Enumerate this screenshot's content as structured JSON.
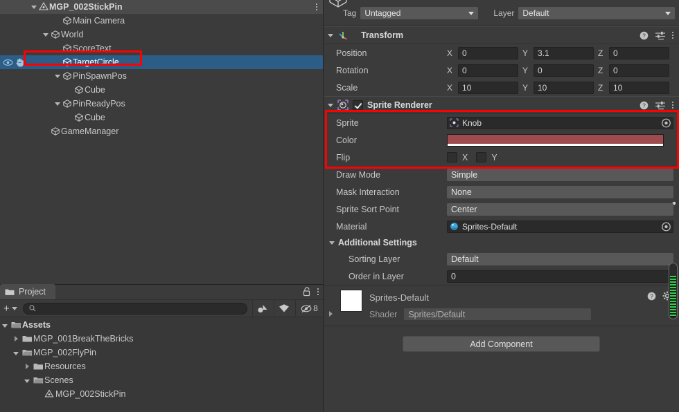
{
  "hierarchy": {
    "scene": {
      "name": "MGP_002StickPin",
      "icon": "unity-scene-icon",
      "menu_icon": "kebab-menu-icon"
    },
    "items": [
      {
        "label": "Main Camera",
        "depth": 2,
        "expander": "none",
        "selected": false,
        "icon": "gameobject-cube-icon"
      },
      {
        "label": "World",
        "depth": 1,
        "expander": "down",
        "selected": false,
        "icon": "gameobject-cube-icon"
      },
      {
        "label": "ScoreText",
        "depth": 2,
        "expander": "none",
        "selected": false,
        "icon": "gameobject-cube-icon"
      },
      {
        "label": "TargetCircle",
        "depth": 2,
        "expander": "none",
        "selected": true,
        "icon": "gameobject-cube-icon"
      },
      {
        "label": "PinSpawnPos",
        "depth": 2,
        "expander": "down",
        "selected": false,
        "icon": "gameobject-cube-icon"
      },
      {
        "label": "Cube",
        "depth": 3,
        "expander": "none",
        "selected": false,
        "icon": "gameobject-cube-icon"
      },
      {
        "label": "PinReadyPos",
        "depth": 2,
        "expander": "down",
        "selected": false,
        "icon": "gameobject-cube-icon"
      },
      {
        "label": "Cube",
        "depth": 3,
        "expander": "none",
        "selected": false,
        "icon": "gameobject-cube-icon"
      },
      {
        "label": "GameManager",
        "depth": 1,
        "expander": "none",
        "selected": false,
        "icon": "gameobject-cube-icon"
      }
    ],
    "gutter_icons": [
      "visibility-eye-icon",
      "pickability-hand-icon"
    ]
  },
  "project": {
    "tab_label": "Project",
    "tab_icon": "folder-icon",
    "lock_icon": "lock-open-icon",
    "menu_icon": "kebab-menu-icon",
    "create_label": "+",
    "search": {
      "value": "",
      "placeholder": "",
      "icon": "search-icon"
    },
    "filter_buttons": [
      {
        "name": "filter-by-type-icon",
        "label": ""
      },
      {
        "name": "filter-by-label-icon",
        "label": ""
      },
      {
        "name": "hidden-items-icon",
        "label": "8"
      }
    ],
    "tree": [
      {
        "label": "Assets",
        "depth": 0,
        "expander": "down",
        "folder": "open",
        "bold": true
      },
      {
        "label": "MGP_001BreakTheBricks",
        "depth": 1,
        "expander": "right",
        "folder": "closed",
        "bold": false
      },
      {
        "label": "MGP_002FlyPin",
        "depth": 1,
        "expander": "down",
        "folder": "open",
        "bold": false
      },
      {
        "label": "Resources",
        "depth": 2,
        "expander": "right",
        "folder": "closed",
        "bold": false
      },
      {
        "label": "Scenes",
        "depth": 2,
        "expander": "down",
        "folder": "open",
        "bold": false
      },
      {
        "label": "MGP_002StickPin",
        "depth": 3,
        "expander": "none",
        "folder": "scene",
        "bold": false
      }
    ]
  },
  "inspector": {
    "preview_icon": "gameobject-cube-icon",
    "tag": {
      "label": "Tag",
      "value": "Untagged"
    },
    "layer": {
      "label": "Layer",
      "value": "Default"
    },
    "transform": {
      "title": "Transform",
      "icon": "transform-axis-icon",
      "help_icon": "help-icon",
      "preset_icon": "preset-icon",
      "menu_icon": "kebab-menu-icon",
      "rows": [
        {
          "label": "Position",
          "x": "0",
          "y": "3.1",
          "z": "0"
        },
        {
          "label": "Rotation",
          "x": "0",
          "y": "0",
          "z": "0"
        },
        {
          "label": "Scale",
          "x": "10",
          "y": "10",
          "z": "10"
        }
      ],
      "axes": [
        "X",
        "Y",
        "Z"
      ]
    },
    "sprite_renderer": {
      "title": "Sprite Renderer",
      "icon": "sprite-renderer-icon",
      "enabled": true,
      "help_icon": "help-icon",
      "preset_icon": "preset-icon",
      "menu_icon": "kebab-menu-icon",
      "sprite": {
        "label": "Sprite",
        "value": "Knob",
        "icon": "sprite-asset-icon",
        "picker_icon": "object-picker-icon"
      },
      "color": {
        "label": "Color",
        "hex": "#9e4b50",
        "alpha_hex": "#ffffff",
        "eyedropper_icon": "eyedropper-icon"
      },
      "flip": {
        "label": "Flip",
        "x_label": "X",
        "y_label": "Y",
        "x_checked": false,
        "y_checked": false
      },
      "draw_mode": {
        "label": "Draw Mode",
        "value": "Simple"
      },
      "mask_interaction": {
        "label": "Mask Interaction",
        "value": "None"
      },
      "sprite_sort_point": {
        "label": "Sprite Sort Point",
        "value": "Center"
      },
      "material": {
        "label": "Material",
        "value": "Sprites-Default",
        "icon": "material-sphere-icon",
        "picker_icon": "object-picker-icon"
      },
      "additional_settings": {
        "label": "Additional Settings",
        "sorting_layer": {
          "label": "Sorting Layer",
          "value": "Default"
        },
        "order_in_layer": {
          "label": "Order in Layer",
          "value": "0"
        }
      }
    },
    "material_preview": {
      "name": "Sprites-Default",
      "shader_label": "Shader",
      "shader_value": "Sprites/Default",
      "help_icon": "help-icon",
      "gear_icon": "gear-icon",
      "fold_icon": "chevron-right-icon"
    },
    "add_component_label": "Add Component",
    "scrollbar": {
      "name": "inspector-vertical-scrollbar"
    }
  },
  "annotations": {
    "highlight_color": "#ff0000",
    "boxes": [
      {
        "name": "hierarchy-target-circle-highlight"
      },
      {
        "name": "sprite-renderer-color-highlight"
      }
    ]
  }
}
